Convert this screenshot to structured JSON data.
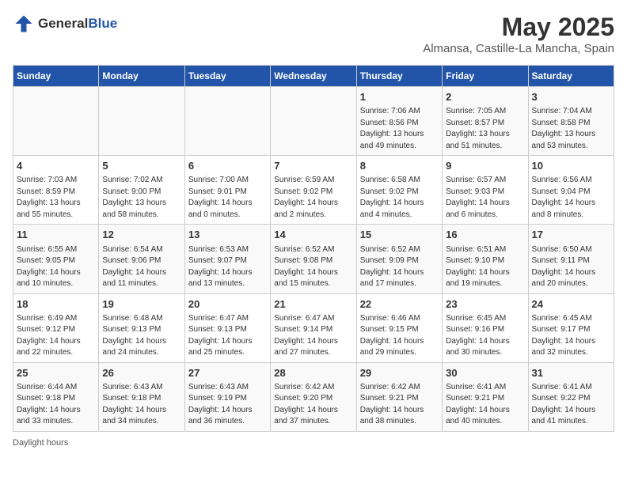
{
  "logo": {
    "general": "General",
    "blue": "Blue"
  },
  "title": "May 2025",
  "subtitle": "Almansa, Castille-La Mancha, Spain",
  "days_of_week": [
    "Sunday",
    "Monday",
    "Tuesday",
    "Wednesday",
    "Thursday",
    "Friday",
    "Saturday"
  ],
  "footer": "Daylight hours",
  "weeks": [
    [
      {
        "day": "",
        "info": ""
      },
      {
        "day": "",
        "info": ""
      },
      {
        "day": "",
        "info": ""
      },
      {
        "day": "",
        "info": ""
      },
      {
        "day": "1",
        "info": "Sunrise: 7:06 AM\nSunset: 8:56 PM\nDaylight: 13 hours\nand 49 minutes."
      },
      {
        "day": "2",
        "info": "Sunrise: 7:05 AM\nSunset: 8:57 PM\nDaylight: 13 hours\nand 51 minutes."
      },
      {
        "day": "3",
        "info": "Sunrise: 7:04 AM\nSunset: 8:58 PM\nDaylight: 13 hours\nand 53 minutes."
      }
    ],
    [
      {
        "day": "4",
        "info": "Sunrise: 7:03 AM\nSunset: 8:59 PM\nDaylight: 13 hours\nand 55 minutes."
      },
      {
        "day": "5",
        "info": "Sunrise: 7:02 AM\nSunset: 9:00 PM\nDaylight: 13 hours\nand 58 minutes."
      },
      {
        "day": "6",
        "info": "Sunrise: 7:00 AM\nSunset: 9:01 PM\nDaylight: 14 hours\nand 0 minutes."
      },
      {
        "day": "7",
        "info": "Sunrise: 6:59 AM\nSunset: 9:02 PM\nDaylight: 14 hours\nand 2 minutes."
      },
      {
        "day": "8",
        "info": "Sunrise: 6:58 AM\nSunset: 9:02 PM\nDaylight: 14 hours\nand 4 minutes."
      },
      {
        "day": "9",
        "info": "Sunrise: 6:57 AM\nSunset: 9:03 PM\nDaylight: 14 hours\nand 6 minutes."
      },
      {
        "day": "10",
        "info": "Sunrise: 6:56 AM\nSunset: 9:04 PM\nDaylight: 14 hours\nand 8 minutes."
      }
    ],
    [
      {
        "day": "11",
        "info": "Sunrise: 6:55 AM\nSunset: 9:05 PM\nDaylight: 14 hours\nand 10 minutes."
      },
      {
        "day": "12",
        "info": "Sunrise: 6:54 AM\nSunset: 9:06 PM\nDaylight: 14 hours\nand 11 minutes."
      },
      {
        "day": "13",
        "info": "Sunrise: 6:53 AM\nSunset: 9:07 PM\nDaylight: 14 hours\nand 13 minutes."
      },
      {
        "day": "14",
        "info": "Sunrise: 6:52 AM\nSunset: 9:08 PM\nDaylight: 14 hours\nand 15 minutes."
      },
      {
        "day": "15",
        "info": "Sunrise: 6:52 AM\nSunset: 9:09 PM\nDaylight: 14 hours\nand 17 minutes."
      },
      {
        "day": "16",
        "info": "Sunrise: 6:51 AM\nSunset: 9:10 PM\nDaylight: 14 hours\nand 19 minutes."
      },
      {
        "day": "17",
        "info": "Sunrise: 6:50 AM\nSunset: 9:11 PM\nDaylight: 14 hours\nand 20 minutes."
      }
    ],
    [
      {
        "day": "18",
        "info": "Sunrise: 6:49 AM\nSunset: 9:12 PM\nDaylight: 14 hours\nand 22 minutes."
      },
      {
        "day": "19",
        "info": "Sunrise: 6:48 AM\nSunset: 9:13 PM\nDaylight: 14 hours\nand 24 minutes."
      },
      {
        "day": "20",
        "info": "Sunrise: 6:47 AM\nSunset: 9:13 PM\nDaylight: 14 hours\nand 25 minutes."
      },
      {
        "day": "21",
        "info": "Sunrise: 6:47 AM\nSunset: 9:14 PM\nDaylight: 14 hours\nand 27 minutes."
      },
      {
        "day": "22",
        "info": "Sunrise: 6:46 AM\nSunset: 9:15 PM\nDaylight: 14 hours\nand 29 minutes."
      },
      {
        "day": "23",
        "info": "Sunrise: 6:45 AM\nSunset: 9:16 PM\nDaylight: 14 hours\nand 30 minutes."
      },
      {
        "day": "24",
        "info": "Sunrise: 6:45 AM\nSunset: 9:17 PM\nDaylight: 14 hours\nand 32 minutes."
      }
    ],
    [
      {
        "day": "25",
        "info": "Sunrise: 6:44 AM\nSunset: 9:18 PM\nDaylight: 14 hours\nand 33 minutes."
      },
      {
        "day": "26",
        "info": "Sunrise: 6:43 AM\nSunset: 9:18 PM\nDaylight: 14 hours\nand 34 minutes."
      },
      {
        "day": "27",
        "info": "Sunrise: 6:43 AM\nSunset: 9:19 PM\nDaylight: 14 hours\nand 36 minutes."
      },
      {
        "day": "28",
        "info": "Sunrise: 6:42 AM\nSunset: 9:20 PM\nDaylight: 14 hours\nand 37 minutes."
      },
      {
        "day": "29",
        "info": "Sunrise: 6:42 AM\nSunset: 9:21 PM\nDaylight: 14 hours\nand 38 minutes."
      },
      {
        "day": "30",
        "info": "Sunrise: 6:41 AM\nSunset: 9:21 PM\nDaylight: 14 hours\nand 40 minutes."
      },
      {
        "day": "31",
        "info": "Sunrise: 6:41 AM\nSunset: 9:22 PM\nDaylight: 14 hours\nand 41 minutes."
      }
    ]
  ]
}
